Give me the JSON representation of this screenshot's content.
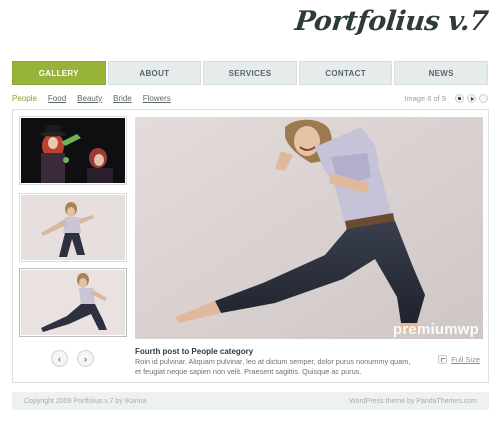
{
  "logo": {
    "text": "Portfolius v.7"
  },
  "nav": {
    "items": [
      {
        "label": "GALLERY",
        "active": true
      },
      {
        "label": "ABOUT"
      },
      {
        "label": "SERVICES"
      },
      {
        "label": "CONTACT"
      },
      {
        "label": "NEWS"
      }
    ]
  },
  "filters": {
    "categories": [
      "People",
      "Food",
      "Beauty",
      "Bride",
      "Flowers"
    ],
    "active": "People",
    "counter": "Image 6 of 9",
    "controls": [
      "stop-icon",
      "play-icon",
      "next-icon"
    ]
  },
  "gallery": {
    "prev_arrow": "‹",
    "next_arrow": "›",
    "watermark": "premiumwp",
    "caption_title": "Fourth post to People category",
    "caption_text": "Roin id pulvinar. Aliquam pulvinar, leo at dictum semper, dolor purus nonummy quam, et feugiat neque sapien non velit. Praesent sagittis. Quisque ac purus.",
    "full_size": "Full Size"
  },
  "footer": {
    "left": "Copyright 2009 Portfolius v.7 by iKarina",
    "right": "WordPress theme by PandaThemes.com"
  }
}
